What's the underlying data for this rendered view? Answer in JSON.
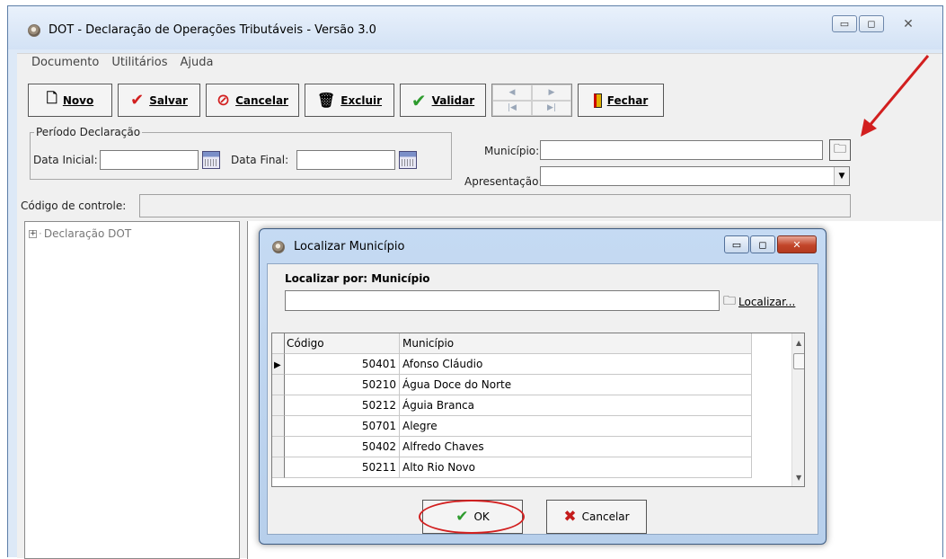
{
  "window": {
    "title": "DOT - Declaração de Operações Tributáveis  - Versão 3.0",
    "caption_icons": [
      "minimize-icon",
      "maximize-icon",
      "close-icon"
    ]
  },
  "menu": [
    "Documento",
    "Utilitários",
    "Ajuda"
  ],
  "toolbar": {
    "novo": "Novo",
    "salvar": "Salvar",
    "cancelar": "Cancelar",
    "excluir": "Excluir",
    "validar": "Validar",
    "fechar": "Fechar"
  },
  "form": {
    "periodo_legend": "Período Declaração",
    "data_inicial_label": "Data Inicial:",
    "data_final_label": "Data Final:",
    "municipio_label": "Município:",
    "apresentacao_label": "Apresentação:",
    "codigo_label": "Código de controle:",
    "data_inicial_value": "",
    "data_final_value": "",
    "municipio_value": "",
    "apresentacao_value": "",
    "codigo_value": ""
  },
  "tree": {
    "root_label": "Declaração DOT"
  },
  "dialog": {
    "title": "Localizar Município",
    "search_label": "Localizar por: Município",
    "search_value": "",
    "search_button": "Localizar...",
    "columns": [
      "Código",
      "Município"
    ],
    "rows": [
      {
        "code": "50401",
        "name": "Afonso Cláudio"
      },
      {
        "code": "50210",
        "name": "Água Doce do Norte"
      },
      {
        "code": "50212",
        "name": "Águia Branca"
      },
      {
        "code": "50701",
        "name": "Alegre"
      },
      {
        "code": "50402",
        "name": "Alfredo Chaves"
      },
      {
        "code": "50211",
        "name": "Alto Rio Novo"
      }
    ],
    "ok_label": "OK",
    "cancel_label": "Cancelar"
  },
  "colors": {
    "annotation_red": "#d21f1f",
    "ok_check_green": "#2e9b2e",
    "cancel_x_red": "#c41b1b"
  }
}
